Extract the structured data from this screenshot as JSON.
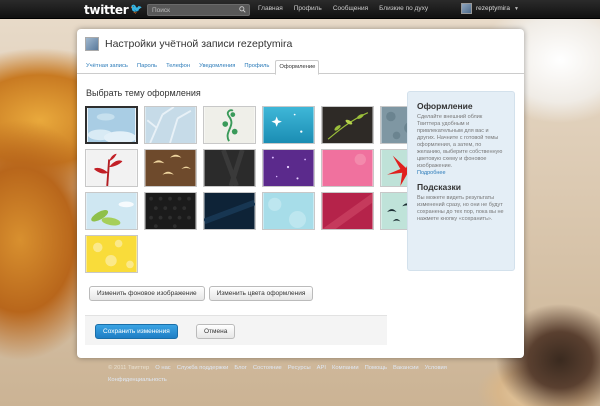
{
  "topbar": {
    "logo": "twitter",
    "search_placeholder": "Поиск",
    "nav": [
      "Главная",
      "Профиль",
      "Сообщения",
      "Близкие по духу"
    ],
    "username": "rezeptymira"
  },
  "panel": {
    "title": "Настройки учётной записи rezeptymira",
    "tabs": [
      "Учётная запись",
      "Пароль",
      "Телефон",
      "Уведомления",
      "Профиль",
      "Оформление"
    ],
    "active_tab": "Оформление",
    "section_title": "Выбрать тему оформления",
    "change_bg_label": "Изменить фоновое изображение",
    "change_colors_label": "Изменить цвета оформления",
    "save_label": "Сохранить изменения",
    "cancel_label": "Отмена"
  },
  "sidebar": {
    "design_title": "Оформление",
    "design_text": "Сделайте внешний облик Твиттера удобным и привлекательным для вас и других. Начните с готовой темы оформления, а затем, по желанию, выберите собственную цветовую схему и фоновое изображение.",
    "more_link": "Подробнее",
    "hints_title": "Подсказки",
    "hints_text": "Вы можете видеть результаты изменений сразу, но они не будут сохранены до тех пор, пока вы не нажмете кнопку «сохранить»."
  },
  "footer": {
    "copyright": "© 2011 Твиттер",
    "links": [
      "О нас",
      "Служба поддержки",
      "Блог",
      "Состояние",
      "Ресурсы",
      "API",
      "Компании",
      "Помощь",
      "Вакансии",
      "Условия",
      "Конфиденциальность"
    ]
  },
  "colors": {
    "accent": "#2b7bb9",
    "save_button": "#1e7ec5",
    "sidebar_bg": "#e4eef6",
    "topbar_bg": "#111111"
  }
}
